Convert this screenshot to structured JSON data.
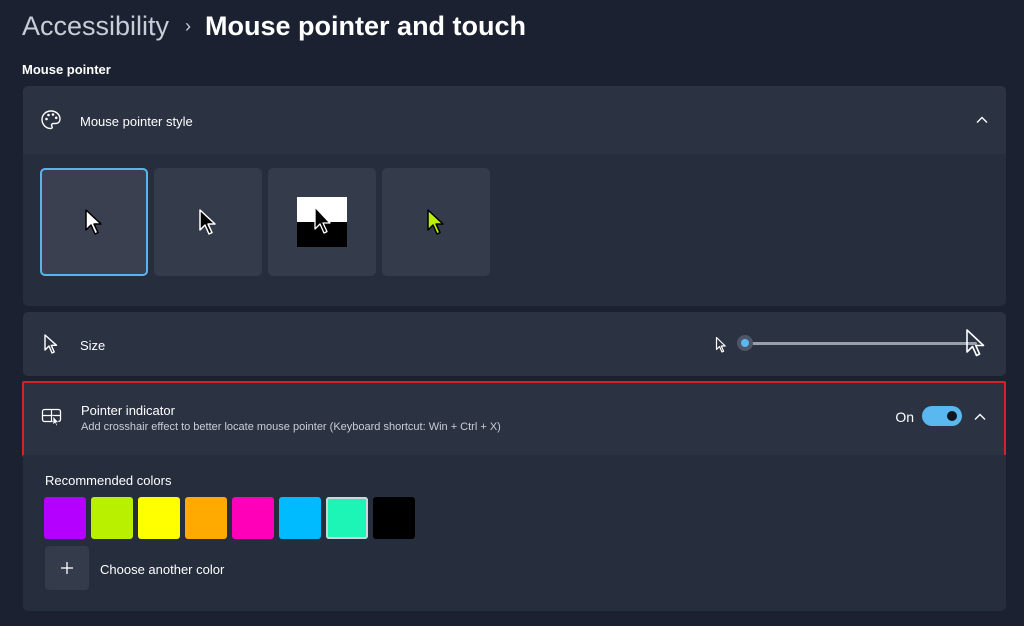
{
  "breadcrumb": {
    "parent": "Accessibility",
    "separator": "›",
    "current": "Mouse pointer and touch"
  },
  "section": {
    "title": "Mouse pointer"
  },
  "pointer_style": {
    "label": "Mouse pointer style",
    "icon": "palette-icon",
    "options": [
      {
        "name": "white",
        "selected": true
      },
      {
        "name": "black",
        "selected": false
      },
      {
        "name": "inverted",
        "selected": false
      },
      {
        "name": "custom",
        "selected": false
      }
    ]
  },
  "size": {
    "label": "Size",
    "icon": "pointer-outline-icon",
    "slider_value_fraction": 0.0
  },
  "pointer_indicator": {
    "label": "Pointer indicator",
    "description": "Add crosshair effect to better locate mouse pointer (Keyboard shortcut: Win + Ctrl + X)",
    "icon": "pointer-indicator-icon",
    "toggle_state": "On"
  },
  "colors": {
    "title": "Recommended colors",
    "swatches": [
      "#b400ff",
      "#b8f000",
      "#ffff00",
      "#ffaa00",
      "#ff00b8",
      "#00bbff",
      "#1cf5b6",
      "#000000"
    ],
    "selected_index": 6,
    "add_label": "Choose another color"
  },
  "accent_color": "#5ab8f0",
  "highlight_border_color": "#d4212a"
}
